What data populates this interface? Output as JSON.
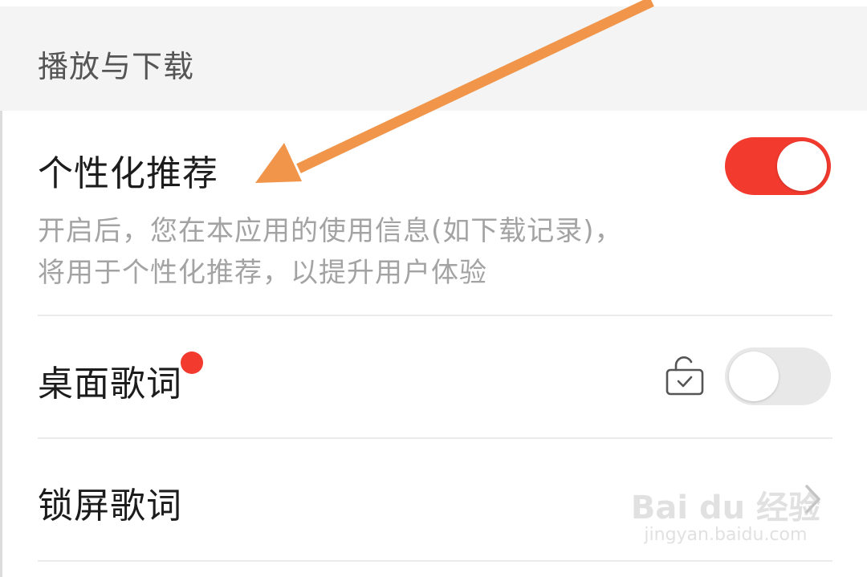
{
  "section": {
    "title": "播放与下载"
  },
  "personalized": {
    "title": "个性化推荐",
    "description_line1": "开启后，您在本应用的使用信息(如下载记录)，",
    "description_line2": "将用于个性化推荐，以提升用户体验",
    "toggle_state": "on"
  },
  "desktop_lyrics": {
    "title": "桌面歌词",
    "has_red_dot": true,
    "toggle_state": "off",
    "lock_icon": "unlock-icon"
  },
  "lockscreen_lyrics": {
    "title": "锁屏歌词",
    "chevron_icon": "chevron-right-icon"
  },
  "watermark": {
    "logo": "Bai du 经验",
    "url": "jingyan.baidu.com"
  },
  "colors": {
    "accent": "#f23a2e",
    "arrow": "#f0954a"
  }
}
